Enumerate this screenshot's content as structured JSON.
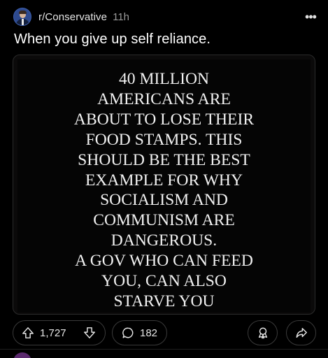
{
  "header": {
    "community": "r/Conservative",
    "time": "11h",
    "more_label": "•••"
  },
  "post": {
    "title": "When you give up self reliance.",
    "image_text_lines": [
      "40 MILLION",
      "AMERICANS ARE",
      "ABOUT TO LOSE THEIR",
      "FOOD STAMPS. THIS",
      "SHOULD BE THE BEST",
      "EXAMPLE FOR WHY",
      "SOCIALISM AND",
      "COMMUNISM ARE",
      "DANGEROUS.",
      "A GOV WHO CAN FEED",
      "YOU, CAN ALSO",
      "STARVE YOU"
    ]
  },
  "actions": {
    "score": "1,727",
    "comments": "182"
  },
  "icons": {
    "upvote": "upvote-arrow-icon",
    "downvote": "downvote-arrow-icon",
    "comment": "comment-bubble-icon",
    "award": "award-icon",
    "share": "share-arrow-icon",
    "more": "more-dots-icon"
  },
  "colors": {
    "background": "#000000",
    "text": "#ffffff",
    "muted": "#9a9a9a",
    "pill_border": "#3a3a3a"
  }
}
